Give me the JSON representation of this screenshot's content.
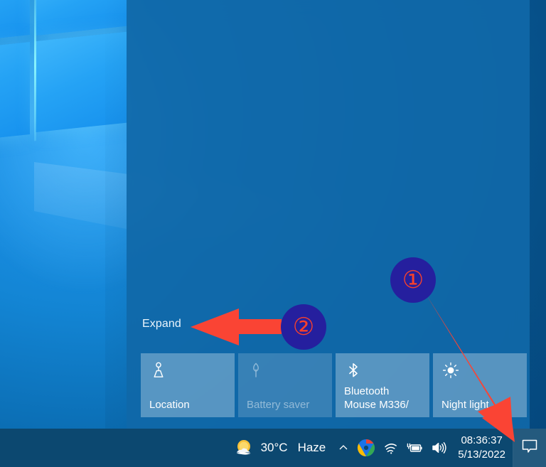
{
  "desktop": {
    "wallpaper_name": "windows-10-hero-logo",
    "background_color": "#0f72b8"
  },
  "action_center": {
    "name": "Action Center",
    "background_color": "#1068a8",
    "expand_label": "Expand",
    "quick_actions": [
      {
        "id": "location",
        "label": "Location",
        "icon": "location-pin-icon",
        "state": "on",
        "tile_color": "#3a86c0"
      },
      {
        "id": "battery-saver",
        "label": "Battery saver",
        "icon": "battery-saver-leaf-icon",
        "state": "disabled",
        "tile_color": "#3a86c0"
      },
      {
        "id": "bluetooth",
        "label": "Bluetooth\nMouse M336/",
        "icon": "bluetooth-icon",
        "state": "on",
        "tile_color": "#2d8fd0"
      },
      {
        "id": "night-light",
        "label": "Night light",
        "icon": "brightness-sun-icon",
        "state": "on",
        "tile_color": "#3a86c0"
      }
    ]
  },
  "taskbar": {
    "background_color": "#0c4870",
    "weather": {
      "icon": "sun-behind-cloud-icon",
      "temperature": "30°C",
      "condition": "Haze"
    },
    "show_hidden_icons_label": "^",
    "tray_icons": [
      {
        "id": "chrome",
        "name": "chrome-icon"
      },
      {
        "id": "network",
        "name": "wifi-icon"
      },
      {
        "id": "battery",
        "name": "battery-charging-icon"
      },
      {
        "id": "volume",
        "name": "speaker-volume-icon"
      }
    ],
    "clock": {
      "time": "08:36:37",
      "date": "5/13/2022"
    },
    "action_center_button": {
      "icon": "speech-bubble-icon",
      "state": "active"
    }
  },
  "annotations": {
    "accent_circle_color": "#251f9e",
    "accent_number_color": "#f8402c",
    "arrow_color": "#fa4434",
    "markers": [
      {
        "number": "1",
        "points_to": "action-center-taskbar-button"
      },
      {
        "number": "2",
        "points_to": "expand-link"
      }
    ]
  }
}
